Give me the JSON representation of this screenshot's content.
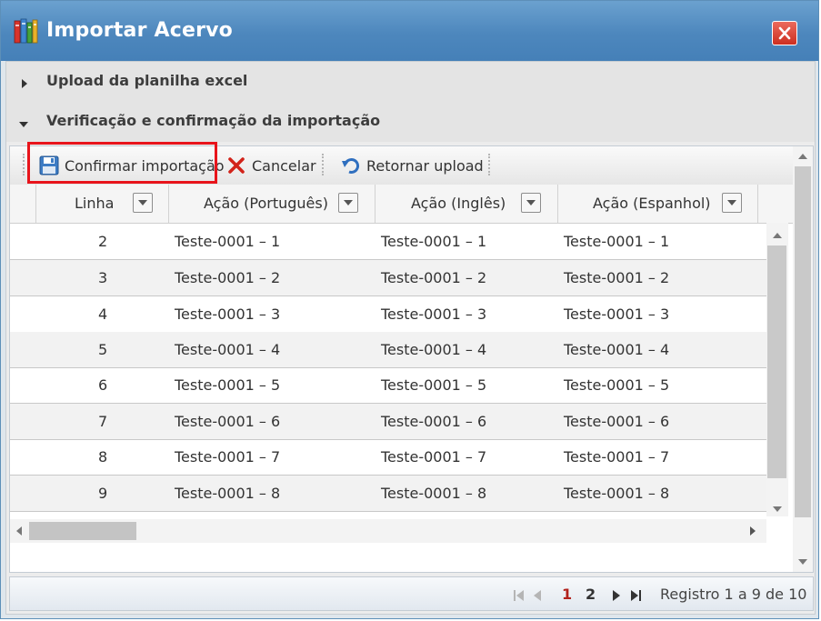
{
  "window": {
    "title": "Importar Acervo",
    "title_icon": "books-icon",
    "close_icon": "close-icon"
  },
  "accordion": [
    {
      "label": "Upload da planilha excel",
      "state": "collapsed"
    },
    {
      "label": "Verificação e confirmação da importação",
      "state": "expanded"
    }
  ],
  "toolbar": {
    "confirm_label": "Confirmar importação",
    "confirm_icon": "save-disk-icon",
    "cancel_label": "Cancelar",
    "cancel_icon": "x-icon",
    "back_label": "Retornar upload",
    "back_icon": "undo-arrow-icon",
    "highlight_color": "#e8141b"
  },
  "grid": {
    "columns": [
      "Linha",
      "Ação (Português)",
      "Ação (Inglês)",
      "Ação (Espanhol)"
    ],
    "rows": [
      {
        "linha": "2",
        "pt": "Teste-0001 – 1",
        "en": "Teste-0001 – 1",
        "es": "Teste-0001 – 1"
      },
      {
        "linha": "3",
        "pt": "Teste-0001 – 2",
        "en": "Teste-0001 – 2",
        "es": "Teste-0001 – 2"
      },
      {
        "linha": "4",
        "pt": "Teste-0001 – 3",
        "en": "Teste-0001 – 3",
        "es": "Teste-0001 – 3"
      },
      {
        "linha": "5",
        "pt": "Teste-0001 – 4",
        "en": "Teste-0001 – 4",
        "es": "Teste-0001 – 4"
      },
      {
        "linha": "6",
        "pt": "Teste-0001 – 5",
        "en": "Teste-0001 – 5",
        "es": "Teste-0001 – 5"
      },
      {
        "linha": "7",
        "pt": "Teste-0001 – 6",
        "en": "Teste-0001 – 6",
        "es": "Teste-0001 – 6"
      },
      {
        "linha": "8",
        "pt": "Teste-0001 – 7",
        "en": "Teste-0001 – 7",
        "es": "Teste-0001 – 7"
      },
      {
        "linha": "9",
        "pt": "Teste-0001 – 8",
        "en": "Teste-0001 – 8",
        "es": "Teste-0001 – 8"
      }
    ]
  },
  "pager": {
    "pages": [
      "1",
      "2"
    ],
    "current_page": "1",
    "current_color": "#b2221c",
    "info": "Registro 1 a 9 de 10"
  }
}
